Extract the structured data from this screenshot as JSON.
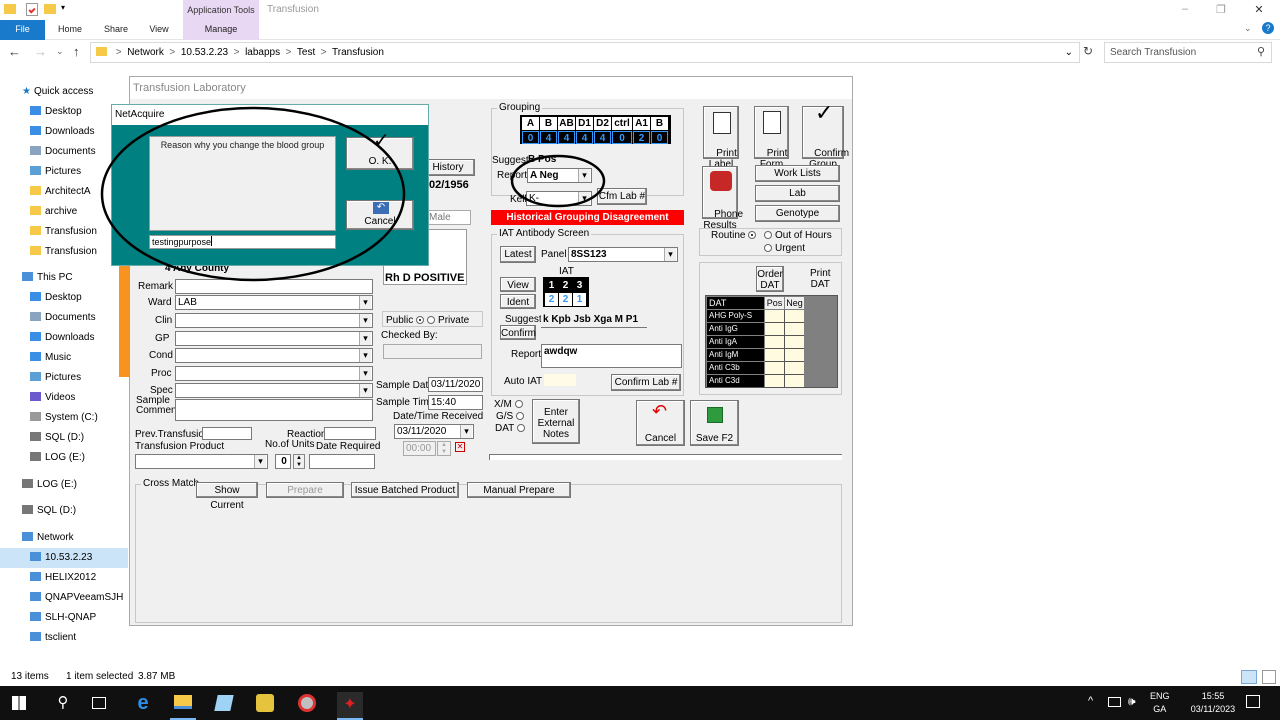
{
  "explorer": {
    "window_title": "Transfusion",
    "context_tab": "Application Tools",
    "ribbon_tabs": [
      "File",
      "Home",
      "Share",
      "View",
      "Manage"
    ],
    "address": {
      "path": [
        "Network",
        "10.53.2.23",
        "labapps",
        "Test",
        "Transfusion"
      ],
      "separator": ">"
    },
    "search_placeholder": "Search Transfusion",
    "nav": {
      "quick_access": "Quick access",
      "quick_items": [
        "Desktop",
        "Downloads",
        "Documents",
        "Pictures",
        "ArchitectA",
        "archive",
        "Transfusion",
        "Transfusion"
      ],
      "this_pc": "This PC",
      "pc_items": [
        "Desktop",
        "Documents",
        "Downloads",
        "Music",
        "Pictures",
        "Videos",
        "System (C:)",
        "SQL (D:)",
        "LOG (E:)"
      ],
      "extra_drives": [
        "LOG (E:)",
        "SQL (D:)"
      ],
      "network": "Network",
      "network_items": [
        "10.53.2.23",
        "HELIX2012",
        "QNAPVeeamSJH",
        "SLH-QNAP",
        "tsclient"
      ]
    },
    "status": {
      "items": "13 items",
      "selected": "1 item selected",
      "size": "3.87 MB"
    }
  },
  "taskbar": {
    "lang_top": "ENG",
    "lang_bottom": "GA",
    "time": "15:55",
    "date": "03/11/2023"
  },
  "tl": {
    "title": "Transfusion Laboratory",
    "history_btn": "History",
    "dob_partial": "02/1956",
    "sex": "Male",
    "address_line": "4 Any County",
    "rh_label": "Rh D POSITIVE",
    "fields": {
      "remark": "Remark",
      "ward": "Ward",
      "ward_value": "LAB",
      "clin": "Clin",
      "gp": "GP",
      "cond": "Cond",
      "proc": "Proc",
      "spec": "Spec",
      "sample_comment": "Sample\nComment",
      "prev_transfusion": "Prev.Transfusion",
      "reaction": "Reaction",
      "transfusion_product": "Transfusion Product",
      "no_of_units": "No.of Units",
      "units_value": "0",
      "date_required": "Date Required"
    },
    "public": "Public",
    "private": "Private",
    "checked_by": "Checked By:",
    "sample_date_label": "Sample Date",
    "sample_date": "03/11/2020",
    "sample_time_label": "Sample Time",
    "sample_time": "15:40",
    "dt_received_label": "Date/Time Received",
    "dt_received_date": "03/11/2020",
    "dt_received_time": "00:00",
    "grouping": {
      "title": "Grouping",
      "headers": [
        "A",
        "B",
        "AB",
        "D1",
        "D2",
        "ctrl",
        "A1",
        "B"
      ],
      "values": [
        "0",
        "4",
        "4",
        "4",
        "4",
        "0",
        "2",
        "0"
      ],
      "suggest_label": "Suggest",
      "suggest_value": "B Pos",
      "report_label": "Report",
      "report_value": "A Neg",
      "kell_label": "Kell",
      "kell_value": "K-",
      "cfm_lab": "Cfm Lab #"
    },
    "disagreement": "Historical Grouping Disagreement",
    "iat": {
      "title": "IAT Antibody Screen",
      "latest": "Latest",
      "panel_label": "Panel",
      "panel_value": "8SS123",
      "iat_label": "IAT",
      "cells_top": [
        "1",
        "2",
        "3"
      ],
      "cells_bottom": [
        "2",
        "2",
        "1"
      ],
      "view": "View",
      "ident": "Ident",
      "suggest": "Suggest",
      "confirm": "Confirm",
      "antibodies": "k Kpb Jsb Xga M P1",
      "report_label": "Report",
      "report_value": "awdqw",
      "auto_iat": "Auto IAT",
      "confirm_lab": "Confirm Lab #"
    },
    "xm": [
      "X/M",
      "G/S",
      "DAT"
    ],
    "enter_notes": "Enter\nExternal\nNotes",
    "cancel": "Cancel",
    "save": "Save F2",
    "right": {
      "print_label": "Print\nLabel",
      "print_form": "Print\nForm",
      "confirm_group": "Confirm\nGroup",
      "phone_results": "Phone\nResults",
      "work_lists": "Work Lists",
      "lab": "Lab",
      "genotype": "Genotype",
      "routine": "Routine",
      "out_of_hours": "Out of Hours",
      "urgent": "Urgent",
      "order_dat": "Order\nDAT",
      "print_dat": "Print\nDAT",
      "dat_headers": [
        "DAT",
        "Pos",
        "Neg"
      ],
      "dat_rows": [
        "AHG Poly-S",
        "Anti IgG",
        "Anti IgA",
        "Anti IgM",
        "Anti C3b",
        "Anti C3d"
      ]
    },
    "cross_match": {
      "title": "Cross Match",
      "show_current": "Show Current",
      "prepare": "Prepare",
      "issue_batched": "Issue Batched Product",
      "manual_prepare": "Manual Prepare"
    }
  },
  "dialog": {
    "title": "NetAcquire",
    "prompt": "Reason why you change the blood group",
    "input_value": "testingpurpose",
    "ok": "O. K.",
    "cancel": "Cancel"
  },
  "colors": {
    "dialog_bg": "#008080",
    "grouping_bg": "#000000",
    "grouping_value": "#3399ff",
    "disagreement_bg": "#ff0000",
    "accent": "#0078d7",
    "taskbar": "#101010"
  }
}
